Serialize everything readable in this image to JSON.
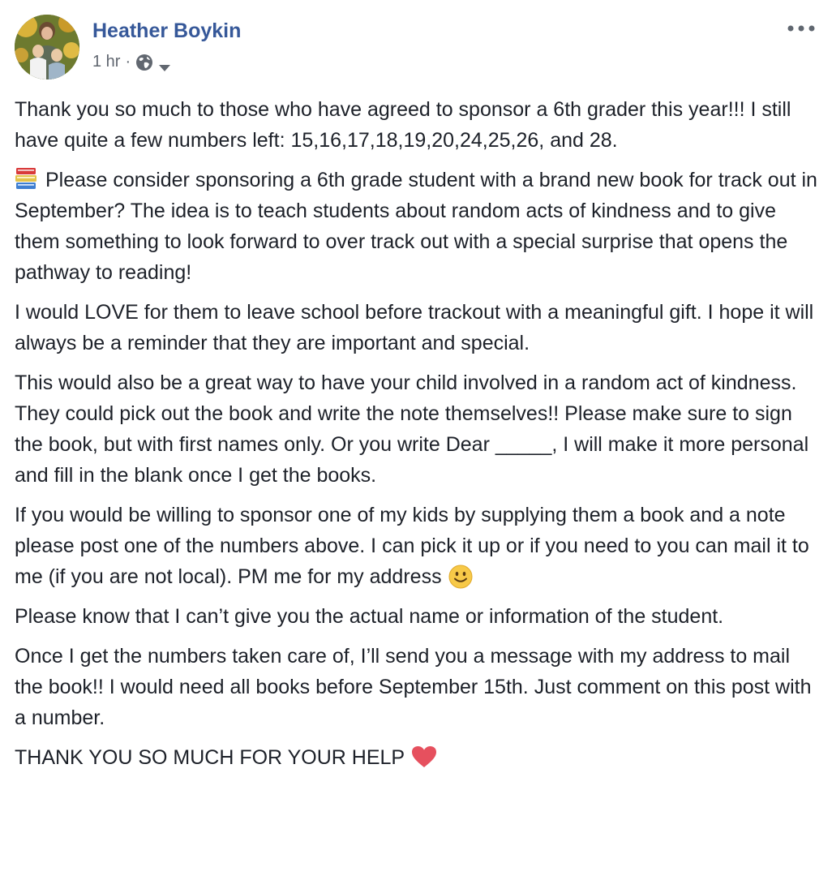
{
  "post": {
    "author": "Heather Boykin",
    "timestamp": "1 hr",
    "separator": "·",
    "privacy_icon": "globe-icon",
    "audience_dropdown_icon": "chevron-down-icon",
    "more_icon": "more-options-icon",
    "link_color": "#365899",
    "meta_color": "#616770",
    "paragraphs": {
      "p1": "Thank you so much to those who have agreed to sponsor a 6th grader this year!!! I still have quite a few numbers left: 15,16,17,18,19,20,24,25,26, and 28.",
      "p2": "Please consider sponsoring a 6th grade student with a brand new book for track out in September? The idea is to teach students about random acts of kindness and to give them something to look forward to over track out with a special surprise that opens the pathway to reading!",
      "p3": "I would LOVE for them to leave school before trackout with a meaningful gift. I hope it will always be a reminder that they are important and special.",
      "p4": "This would also be a great way to have your child involved in a random act of kindness. They could pick out the book and write the note themselves!! Please make sure to sign the book, but with first names only. Or you write Dear _____, I will make it more personal and fill in the blank once I get the books.",
      "p5": "If you would be willing to sponsor one of my kids by supplying them a book and a note please post one of the numbers above. I can pick it up or if you need to you can mail it to me (if you are not local). PM me for my address",
      "p6": "Please know that I can’t give you the actual name or information of the student.",
      "p7": "Once I get the numbers taken care of, I’ll send you a message with my address to mail the book!! I would need all books before September 15th. Just comment on this post with a number.",
      "p8": "THANK YOU SO MUCH FOR YOUR HELP"
    },
    "emojis": {
      "book": "books-emoji-icon",
      "smile": "smiling-face-emoji-icon",
      "heart": "red-heart-emoji-icon"
    }
  }
}
